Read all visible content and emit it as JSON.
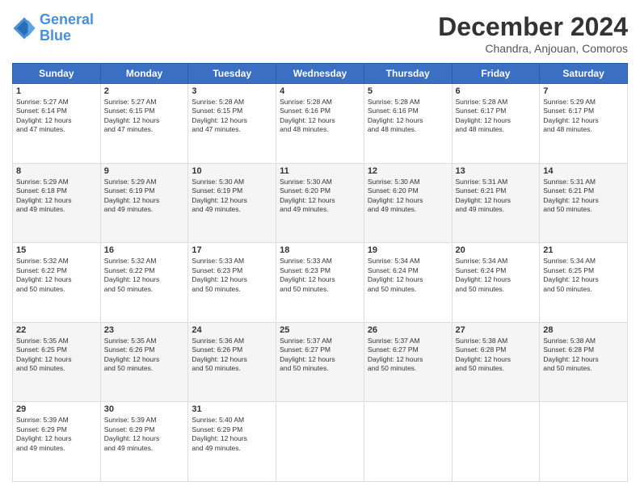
{
  "logo": {
    "line1": "General",
    "line2": "Blue"
  },
  "header": {
    "title": "December 2024",
    "subtitle": "Chandra, Anjouan, Comoros"
  },
  "weekdays": [
    "Sunday",
    "Monday",
    "Tuesday",
    "Wednesday",
    "Thursday",
    "Friday",
    "Saturday"
  ],
  "weeks": [
    [
      {
        "day": "1",
        "sunrise": "5:27 AM",
        "sunset": "6:14 PM",
        "daylight": "12 hours and 47 minutes."
      },
      {
        "day": "2",
        "sunrise": "5:27 AM",
        "sunset": "6:15 PM",
        "daylight": "12 hours and 47 minutes."
      },
      {
        "day": "3",
        "sunrise": "5:28 AM",
        "sunset": "6:15 PM",
        "daylight": "12 hours and 47 minutes."
      },
      {
        "day": "4",
        "sunrise": "5:28 AM",
        "sunset": "6:16 PM",
        "daylight": "12 hours and 48 minutes."
      },
      {
        "day": "5",
        "sunrise": "5:28 AM",
        "sunset": "6:16 PM",
        "daylight": "12 hours and 48 minutes."
      },
      {
        "day": "6",
        "sunrise": "5:28 AM",
        "sunset": "6:17 PM",
        "daylight": "12 hours and 48 minutes."
      },
      {
        "day": "7",
        "sunrise": "5:29 AM",
        "sunset": "6:17 PM",
        "daylight": "12 hours and 48 minutes."
      }
    ],
    [
      {
        "day": "8",
        "sunrise": "5:29 AM",
        "sunset": "6:18 PM",
        "daylight": "12 hours and 49 minutes."
      },
      {
        "day": "9",
        "sunrise": "5:29 AM",
        "sunset": "6:19 PM",
        "daylight": "12 hours and 49 minutes."
      },
      {
        "day": "10",
        "sunrise": "5:30 AM",
        "sunset": "6:19 PM",
        "daylight": "12 hours and 49 minutes."
      },
      {
        "day": "11",
        "sunrise": "5:30 AM",
        "sunset": "6:20 PM",
        "daylight": "12 hours and 49 minutes."
      },
      {
        "day": "12",
        "sunrise": "5:30 AM",
        "sunset": "6:20 PM",
        "daylight": "12 hours and 49 minutes."
      },
      {
        "day": "13",
        "sunrise": "5:31 AM",
        "sunset": "6:21 PM",
        "daylight": "12 hours and 49 minutes."
      },
      {
        "day": "14",
        "sunrise": "5:31 AM",
        "sunset": "6:21 PM",
        "daylight": "12 hours and 50 minutes."
      }
    ],
    [
      {
        "day": "15",
        "sunrise": "5:32 AM",
        "sunset": "6:22 PM",
        "daylight": "12 hours and 50 minutes."
      },
      {
        "day": "16",
        "sunrise": "5:32 AM",
        "sunset": "6:22 PM",
        "daylight": "12 hours and 50 minutes."
      },
      {
        "day": "17",
        "sunrise": "5:33 AM",
        "sunset": "6:23 PM",
        "daylight": "12 hours and 50 minutes."
      },
      {
        "day": "18",
        "sunrise": "5:33 AM",
        "sunset": "6:23 PM",
        "daylight": "12 hours and 50 minutes."
      },
      {
        "day": "19",
        "sunrise": "5:34 AM",
        "sunset": "6:24 PM",
        "daylight": "12 hours and 50 minutes."
      },
      {
        "day": "20",
        "sunrise": "5:34 AM",
        "sunset": "6:24 PM",
        "daylight": "12 hours and 50 minutes."
      },
      {
        "day": "21",
        "sunrise": "5:34 AM",
        "sunset": "6:25 PM",
        "daylight": "12 hours and 50 minutes."
      }
    ],
    [
      {
        "day": "22",
        "sunrise": "5:35 AM",
        "sunset": "6:25 PM",
        "daylight": "12 hours and 50 minutes."
      },
      {
        "day": "23",
        "sunrise": "5:35 AM",
        "sunset": "6:26 PM",
        "daylight": "12 hours and 50 minutes."
      },
      {
        "day": "24",
        "sunrise": "5:36 AM",
        "sunset": "6:26 PM",
        "daylight": "12 hours and 50 minutes."
      },
      {
        "day": "25",
        "sunrise": "5:37 AM",
        "sunset": "6:27 PM",
        "daylight": "12 hours and 50 minutes."
      },
      {
        "day": "26",
        "sunrise": "5:37 AM",
        "sunset": "6:27 PM",
        "daylight": "12 hours and 50 minutes."
      },
      {
        "day": "27",
        "sunrise": "5:38 AM",
        "sunset": "6:28 PM",
        "daylight": "12 hours and 50 minutes."
      },
      {
        "day": "28",
        "sunrise": "5:38 AM",
        "sunset": "6:28 PM",
        "daylight": "12 hours and 50 minutes."
      }
    ],
    [
      {
        "day": "29",
        "sunrise": "5:39 AM",
        "sunset": "6:29 PM",
        "daylight": "12 hours and 49 minutes."
      },
      {
        "day": "30",
        "sunrise": "5:39 AM",
        "sunset": "6:29 PM",
        "daylight": "12 hours and 49 minutes."
      },
      {
        "day": "31",
        "sunrise": "5:40 AM",
        "sunset": "6:29 PM",
        "daylight": "12 hours and 49 minutes."
      },
      null,
      null,
      null,
      null
    ]
  ],
  "labels": {
    "sunrise": "Sunrise: ",
    "sunset": "Sunset: ",
    "daylight": "Daylight: "
  }
}
